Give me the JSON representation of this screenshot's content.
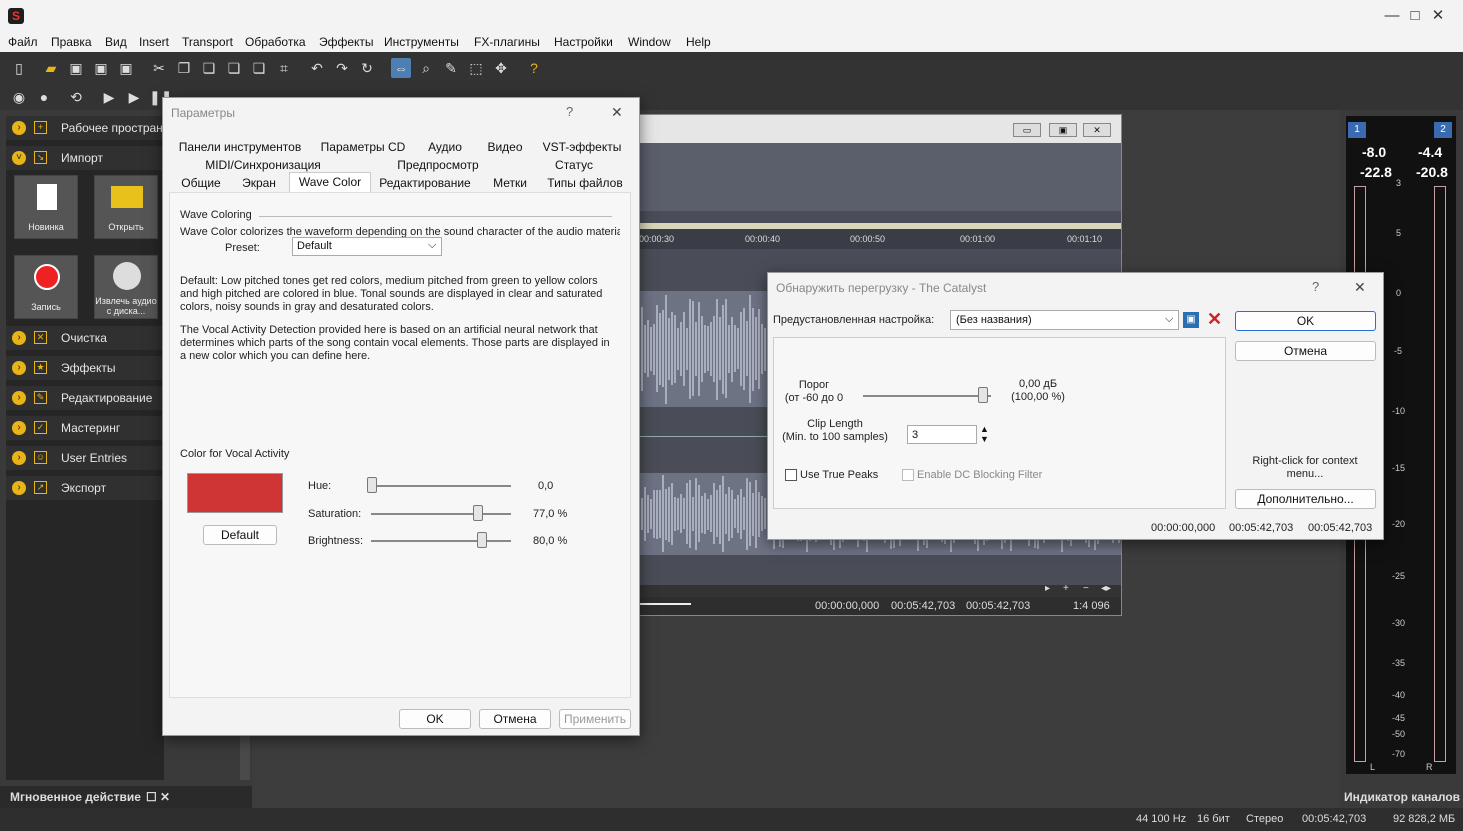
{
  "menu": {
    "items": [
      "Файл",
      "Правка",
      "Вид",
      "Insert",
      "Transport",
      "Обработка",
      "Эффекты",
      "Инструменты",
      "FX-плагины",
      "Настройки",
      "Window",
      "Help"
    ]
  },
  "window_controls": {
    "minimize": "—",
    "maximize": "□",
    "close": "✕"
  },
  "left_panel": {
    "categories": [
      "Рабочее пространство",
      "Импорт",
      "Очистка",
      "Эффекты",
      "Редактирование",
      "Мастеринг",
      "User Entries",
      "Экспорт"
    ],
    "tiles": [
      "Новинка",
      "Открыть",
      "Запись",
      "Извлечь аудио с диска..."
    ],
    "footer": "Мгновенное действие"
  },
  "wave_window": {
    "ruler": [
      "00:00:30",
      "00:00:40",
      "00:00:50",
      "00:01:00",
      "00:01:10"
    ],
    "times": [
      "00:00:00,000",
      "00:05:42,703",
      "00:05:42,703"
    ],
    "zoom": "1:4 096"
  },
  "meter": {
    "ch1": "1",
    "ch2": "2",
    "peak_l": "-8.0",
    "peak_r": "-4.4",
    "rms_l": "-22.8",
    "rms_r": "-20.8",
    "scale": [
      "3",
      "5",
      "0",
      "-5",
      "-10",
      "-15",
      "-20",
      "-25",
      "-30",
      "-35",
      "-40",
      "-45",
      "-50",
      "-70"
    ],
    "l": "L",
    "r": "R",
    "title": "Индикатор каналов"
  },
  "params_dialog": {
    "title": "Параметры",
    "help": "?",
    "close": "✕",
    "tabs_row1": [
      "Панели инструментов",
      "Параметры CD",
      "Аудио",
      "Видео",
      "VST-эффекты"
    ],
    "tabs_row2": [
      "MIDI/Синхронизация",
      "Предпросмотр",
      "Статус"
    ],
    "tabs_row3": [
      "Общие",
      "Экран",
      "Wave Color",
      "Редактирование",
      "Метки",
      "Типы файлов"
    ],
    "section_title": "Wave Coloring",
    "intro": "Wave Color colorizes the waveform depending on the sound character of the audio material.",
    "preset_label": "Preset:",
    "preset_value": "Default",
    "desc1": "Default: Low pitched tones get red colors, medium pitched from green to yellow colors and high pitched are colored in blue. Tonal sounds are displayed in clear and saturated colors, noisy sounds in gray and desaturated colors.",
    "desc2": "The Vocal Activity Detection provided here is based on an artificial neural network that determines which parts of the song contain vocal elements. Those parts are displayed in a new color which you can define here.",
    "vocal_label": "Color for Vocal Activity",
    "swatch_color": "#d03535",
    "default_btn": "Default",
    "hue_label": "Hue:",
    "hue_value": "0,0",
    "sat_label": "Saturation:",
    "sat_value": "77,0 %",
    "bri_label": "Brightness:",
    "bri_value": "80,0 %",
    "ok": "OK",
    "cancel": "Отмена",
    "apply": "Применить"
  },
  "catalyst_dialog": {
    "title": "Обнаружить перегрузку - The Catalyst",
    "help": "?",
    "close": "✕",
    "preset_label": "Предустановленная настройка:",
    "preset_value": "(Без названия)",
    "threshold_label": "Порог\n(от -60 до 0",
    "threshold_value": "0,00 дБ\n(100,00 %)",
    "clip_label": "Clip Length\n(Min. to 100 samples)",
    "clip_value": "3",
    "true_peaks": "Use True Peaks",
    "dc_filter": "Enable DC Blocking Filter",
    "ok": "OK",
    "cancel": "Отмена",
    "context_hint": "Right-click for context menu...",
    "more": "Дополнительно...",
    "times": [
      "00:00:00,000",
      "00:05:42,703",
      "00:05:42,703"
    ]
  },
  "status": {
    "sample_rate": "44 100 Hz",
    "bits": "16 бит",
    "channels": "Стерео",
    "length": "00:05:42,703",
    "size": "92 828,2 МБ"
  }
}
